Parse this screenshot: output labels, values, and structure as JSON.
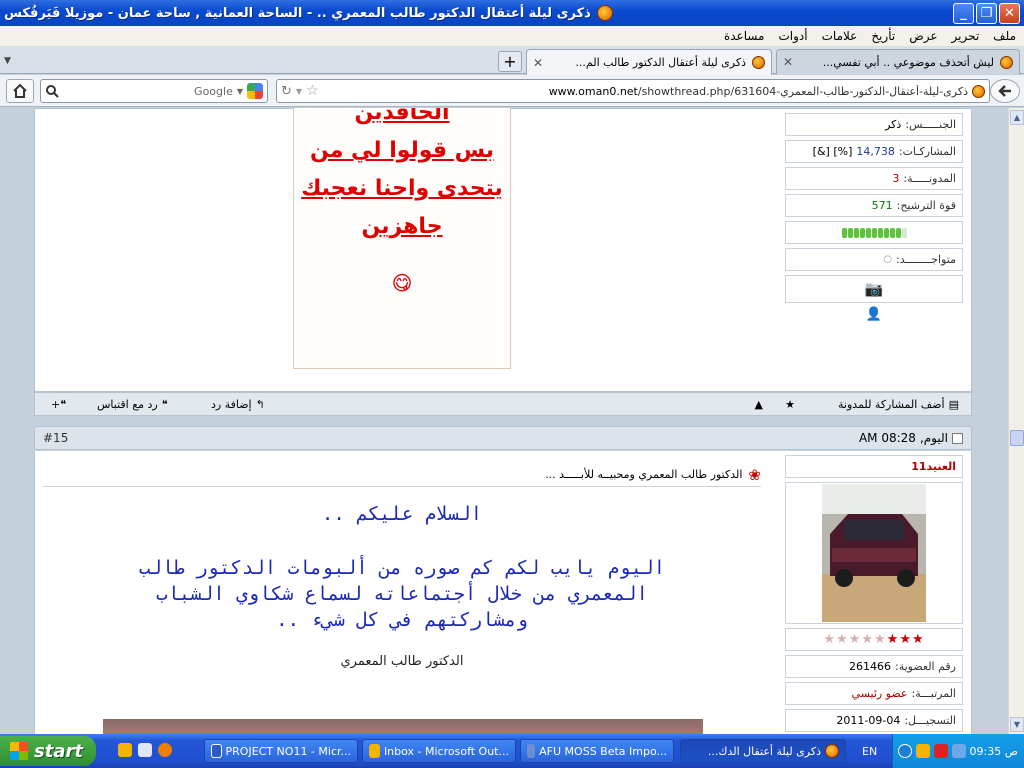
{
  "window": {
    "title": "ذكرى ليلة أعتقال الدكتور طالب المعمري .. - الساحة العمانية , ساحة عمان - موزيلا فَيَرفُكس"
  },
  "menu": [
    "ملف",
    "تحرير",
    "عرض",
    "تأريخ",
    "علامات",
    "أدوات",
    "مساعدة"
  ],
  "tabs": [
    {
      "label": "ليش أتحذف موضوعي .. أبي تفسي...",
      "active": false
    },
    {
      "label": "ذكرى ليلة أعتقال الدكتور طالب الم...",
      "active": true
    }
  ],
  "nav": {
    "url_host": "www.oman0.net",
    "url_path": "/showthread.php/631604-ذكرى-ليلة-أعتقال-الدكتور-طالب-المعمري",
    "search_placeholder": "Google"
  },
  "post14": {
    "signature_lines": [
      "الحاقدين",
      "بس قولوا لي من",
      "يتحدى واحنا نعجبك",
      "جاهزين"
    ],
    "user": {
      "gender_label": "الجنـــــس:",
      "gender": "ذكر",
      "posts_label": "المشاركـات:",
      "posts": "14,738",
      "posts_extra": "[%] [&]",
      "blog_label": "المدونـــــة:",
      "blog": "3",
      "rep_label": "قوة الترشيح:",
      "rep": "571",
      "rep_level": 0.9,
      "online_label": "متواجــــــــد:"
    },
    "footer": {
      "add_blog": "أضف المشاركة للمدونة",
      "add_reply": "إضافة رد",
      "quote_reply": "رد مع اقتباس"
    }
  },
  "post15": {
    "number": "#15",
    "date_label": "اليوم,",
    "time": "08:28 AM",
    "username": "العنيد11",
    "rating": {
      "filled": 3,
      "total": 8
    },
    "member_no_label": "رقم العضوية:",
    "member_no": "261466",
    "rank_label": "المرتبـــة:",
    "rank": "عضو رئيسي",
    "joined_label": "التسجيـــل:",
    "joined": "2011-09-04",
    "post_title": "الدكتور طالب المعمري ومحبيــه للأبـــــد ...",
    "greeting": "السلام عليكم ..",
    "body_lines": [
      "اليوم يايب لكم كم صوره من ألبومات الدكتور طالب",
      "المعمري من خلال أجتماعاته لسماع شكاوي الشباب",
      "ومشاركتهم في كل شيء .."
    ],
    "caption": "الدكتور طالب المعمري"
  },
  "taskbar": {
    "start": "start",
    "items": [
      "PROJECT NO11 - Micr...",
      "Inbox - Microsoft Out...",
      "AFU MOSS Beta Impo...",
      "ذكرى ليلة أعتقال الدك..."
    ],
    "lang": "EN",
    "clock": "ص 09:35"
  },
  "colors": {
    "accent": "#1a3c8e",
    "red_text": "#e00000",
    "blue_text": "#1c28b8",
    "titlebar": "#0a4bd0"
  }
}
